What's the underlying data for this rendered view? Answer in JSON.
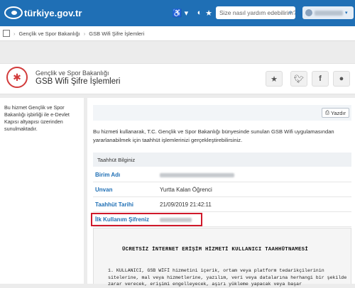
{
  "header": {
    "logo_text": "türkiye.gov.tr",
    "accessibility_label": "♿ ▾",
    "search_placeholder": "Size nasıl yardım edebilirim?"
  },
  "breadcrumb": {
    "items": [
      "Gençlik ve Spor Bakanlığı",
      "GSB Wifi Şifre İşlemleri"
    ]
  },
  "service": {
    "ministry": "Gençlik ve Spor Bakanlığı",
    "title": "GSB Wifi Şifre İşlemleri"
  },
  "sidebar": {
    "note": "Bu hizmet Gençlik ve Spor Bakanlığı işbirliği ile e-Devlet Kapısı altyapısı üzerinden sunulmaktadır."
  },
  "toolbar": {
    "print_label": "Yazdır"
  },
  "main": {
    "intro": "Bu hizmeti kullanarak, T.C. Gençlik ve Spor Bakanlığı bünyesinde sunulan GSB Wifi uygulamasından yararlanabilmek için taahhüt işlemlerinizi gerçekleştirebilirsiniz.",
    "section_title": "Taahhüt Bilginiz",
    "rows": [
      {
        "label": "Birim Adı",
        "value": ""
      },
      {
        "label": "Unvan",
        "value": "Yurtta Kalan Öğrenci"
      },
      {
        "label": "Taahhüt Tarihi",
        "value": "21/09/2019 21:42:11"
      },
      {
        "label": "İlk Kullanım Şifreniz",
        "value": ""
      }
    ]
  },
  "document": {
    "title": "ÜCRETSİZ İNTERNET ERİŞİM HİZMETİ KULLANICI TAAHHÜTNAMESİ",
    "paragraph": "1. KULLANICI, GSB WİFİ hizmetini içerik, ortam veya platform tedarikçilerinin sitelerine, mal veya hizmetlerine, yazılım, veri veya datalarına herhangi bir şekilde zarar verecek, erişimi engelleyecek, aşırı yükleme yapacak veya başar"
  },
  "colors": {
    "brand": "#1f6fb5",
    "highlight": "#d0192b"
  }
}
